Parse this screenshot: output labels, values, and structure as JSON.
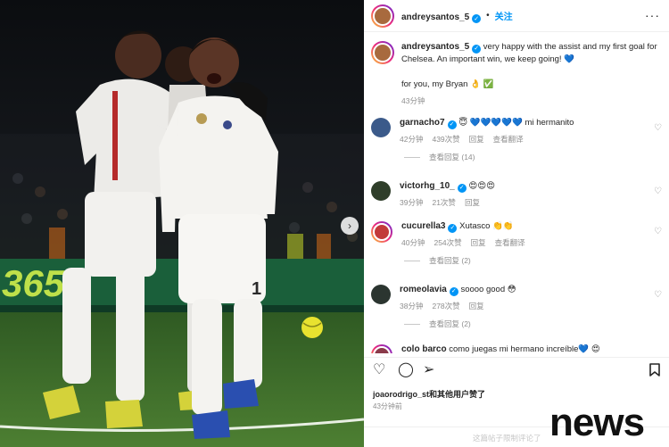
{
  "post": {
    "author": "andreysantos_5",
    "follow_label": "关注",
    "separator": "•"
  },
  "caption": {
    "author": "andreysantos_5",
    "text": "very happy with the assist and my first goal for Chelsea. An important win, we keep going! 💙",
    "text2": "for you, my Bryan 👌 ✅",
    "time": "43分钟"
  },
  "comments": [
    {
      "user": "garnacho7",
      "text": "😇 💙💙💙💙💙 mi hermanito",
      "time": "42分钟",
      "likes": "439次赞",
      "reply": "回复",
      "translate": "查看翻译",
      "view_replies": "查看回复 (14)"
    },
    {
      "user": "victorhg_10_",
      "text": "😍😍😍",
      "time": "39分钟",
      "likes": "21次赞",
      "reply": "回复",
      "translate": "",
      "view_replies": ""
    },
    {
      "user": "cucurella3",
      "text": "Xutasco 👏👏",
      "time": "40分钟",
      "likes": "254次赞",
      "reply": "回复",
      "translate": "查看翻译",
      "view_replies": "查看回复 (2)"
    },
    {
      "user": "romeolavia",
      "text": "soooo good 😳",
      "time": "38分钟",
      "likes": "278次赞",
      "reply": "回复",
      "translate": "",
      "view_replies": "查看回复 (2)"
    },
    {
      "user": "colo barco",
      "text": "como juegas mi hermano increíble💙 😍",
      "time": "",
      "likes": "",
      "reply": "",
      "translate": "",
      "view_replies": ""
    }
  ],
  "icons": {
    "like": "heart-icon",
    "comment": "comment-icon",
    "share": "share-icon",
    "save": "bookmark-icon",
    "next": "chevron-right-icon"
  },
  "likes_line": {
    "user": "joaorodrigo_st",
    "rest": "和其他用户赞了"
  },
  "post_time": "43分钟前",
  "footer_text": "这篇帖子限制评论了",
  "watermark": "news",
  "colors": {
    "accent": "#0095f6",
    "text": "#262626",
    "muted": "#8e8e8e"
  }
}
